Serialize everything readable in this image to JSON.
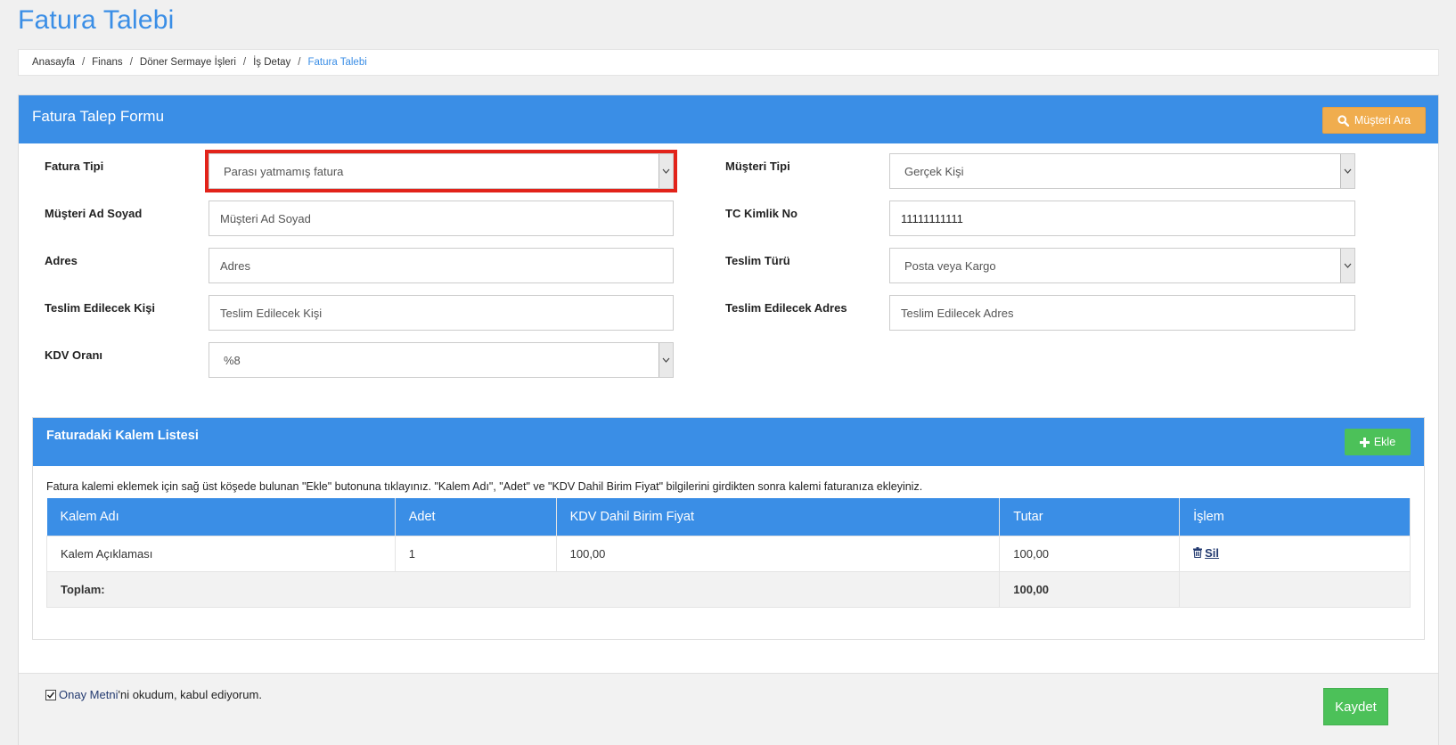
{
  "page": {
    "title": "Fatura Talebi"
  },
  "breadcrumb": [
    "Anasayfa",
    "Finans",
    "Döner Sermaye İşleri",
    "İş Detay",
    "Fatura Talebi"
  ],
  "form": {
    "title": "Fatura Talep Formu",
    "customer_search_label": "Müşteri Ara",
    "fields": {
      "fatura_tipi": {
        "label": "Fatura Tipi",
        "value": "Parası yatmamış fatura"
      },
      "musteri_tipi": {
        "label": "Müşteri Tipi",
        "value": "Gerçek Kişi"
      },
      "musteri_ad_soyad": {
        "label": "Müşteri Ad Soyad",
        "placeholder": "Müşteri Ad Soyad"
      },
      "tc_kimlik_no": {
        "label": "TC Kimlik No",
        "value": "11111111111"
      },
      "adres": {
        "label": "Adres",
        "placeholder": "Adres"
      },
      "teslim_turu": {
        "label": "Teslim Türü",
        "value": "Posta veya Kargo"
      },
      "teslim_edilecek_kisi": {
        "label": "Teslim Edilecek Kişi",
        "placeholder": "Teslim Edilecek Kişi"
      },
      "teslim_edilecek_adres": {
        "label": "Teslim Edilecek Adres",
        "placeholder": "Teslim Edilecek Adres"
      },
      "kdv_orani": {
        "label": "KDV Oranı",
        "value": "%8"
      }
    }
  },
  "items": {
    "title": "Faturadaki Kalem Listesi",
    "add_label": "Ekle",
    "note": "Fatura kalemi eklemek için sağ üst köşede bulunan \"Ekle\" butonuna tıklayınız. \"Kalem Adı\", \"Adet\" ve \"KDV Dahil Birim Fiyat\" bilgilerini girdikten sonra kalemi faturanıza ekleyiniz.",
    "columns": [
      "Kalem Adı",
      "Adet",
      "KDV Dahil Birim Fiyat",
      "Tutar",
      "İşlem"
    ],
    "rows": [
      {
        "name": "Kalem Açıklaması",
        "qty": "1",
        "unit_price": "100,00",
        "total": "100,00",
        "action": "Sil"
      }
    ],
    "total_label": "Toplam:",
    "total_value": "100,00"
  },
  "footer": {
    "consent_link": "Onay Metni",
    "consent_text": "'ni okudum, kabul ediyorum.",
    "save_label": "Kaydet"
  },
  "colors": {
    "primary": "#3a8ee6",
    "warning": "#f0ad4e",
    "success": "#4cc159",
    "highlight": "#e2231a"
  }
}
